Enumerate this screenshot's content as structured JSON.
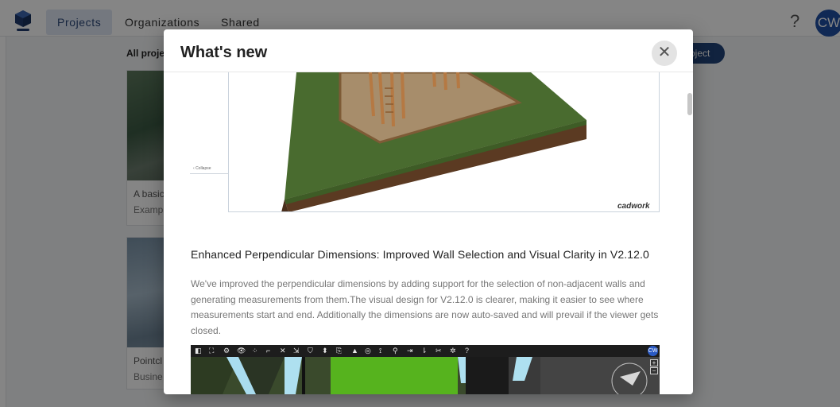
{
  "app": {
    "logo": "cube-logo-icon",
    "tabs": [
      {
        "label": "Projects",
        "active": true
      },
      {
        "label": "Organizations",
        "active": false
      },
      {
        "label": "Shared",
        "active": false
      }
    ],
    "help_icon": "?",
    "avatar": "CW"
  },
  "background": {
    "heading": "All projec",
    "new_project_button": "oject",
    "cards": [
      {
        "title": "A basic",
        "subtitle": "Exampl"
      },
      {
        "title": "Pointcl",
        "subtitle": "Busine"
      }
    ]
  },
  "modal": {
    "title": "What's new",
    "close_icon": "✕",
    "screenshot1": {
      "collapse_label": "Collapse",
      "watermark": "cadwork"
    },
    "section": {
      "title": "Enhanced Perpendicular Dimensions: Improved Wall Selection and Visual Clarity in V2.12.0",
      "description": "We've improved the perpendicular dimensions by adding support for the selection of non-adjacent walls and generating measurements from them.The visual design for V2.12.0 is clearer, making it easier to see where measurements start and end. Additionally the dimensions are now auto-saved and will prevail if the viewer gets closed."
    },
    "screenshot2": {
      "toolbar_icons": [
        "◧",
        "⛶",
        "⚙",
        "👁",
        "⁘",
        "⌐",
        "✕",
        "⇲",
        "⛉",
        "⬍",
        "⎘",
        "▲",
        "◎",
        "⟟",
        "⚲",
        "⇥",
        "⇂",
        "✂",
        "✲",
        "?"
      ],
      "avatar": "CW",
      "zoom_in": "+",
      "zoom_out": "−"
    }
  }
}
